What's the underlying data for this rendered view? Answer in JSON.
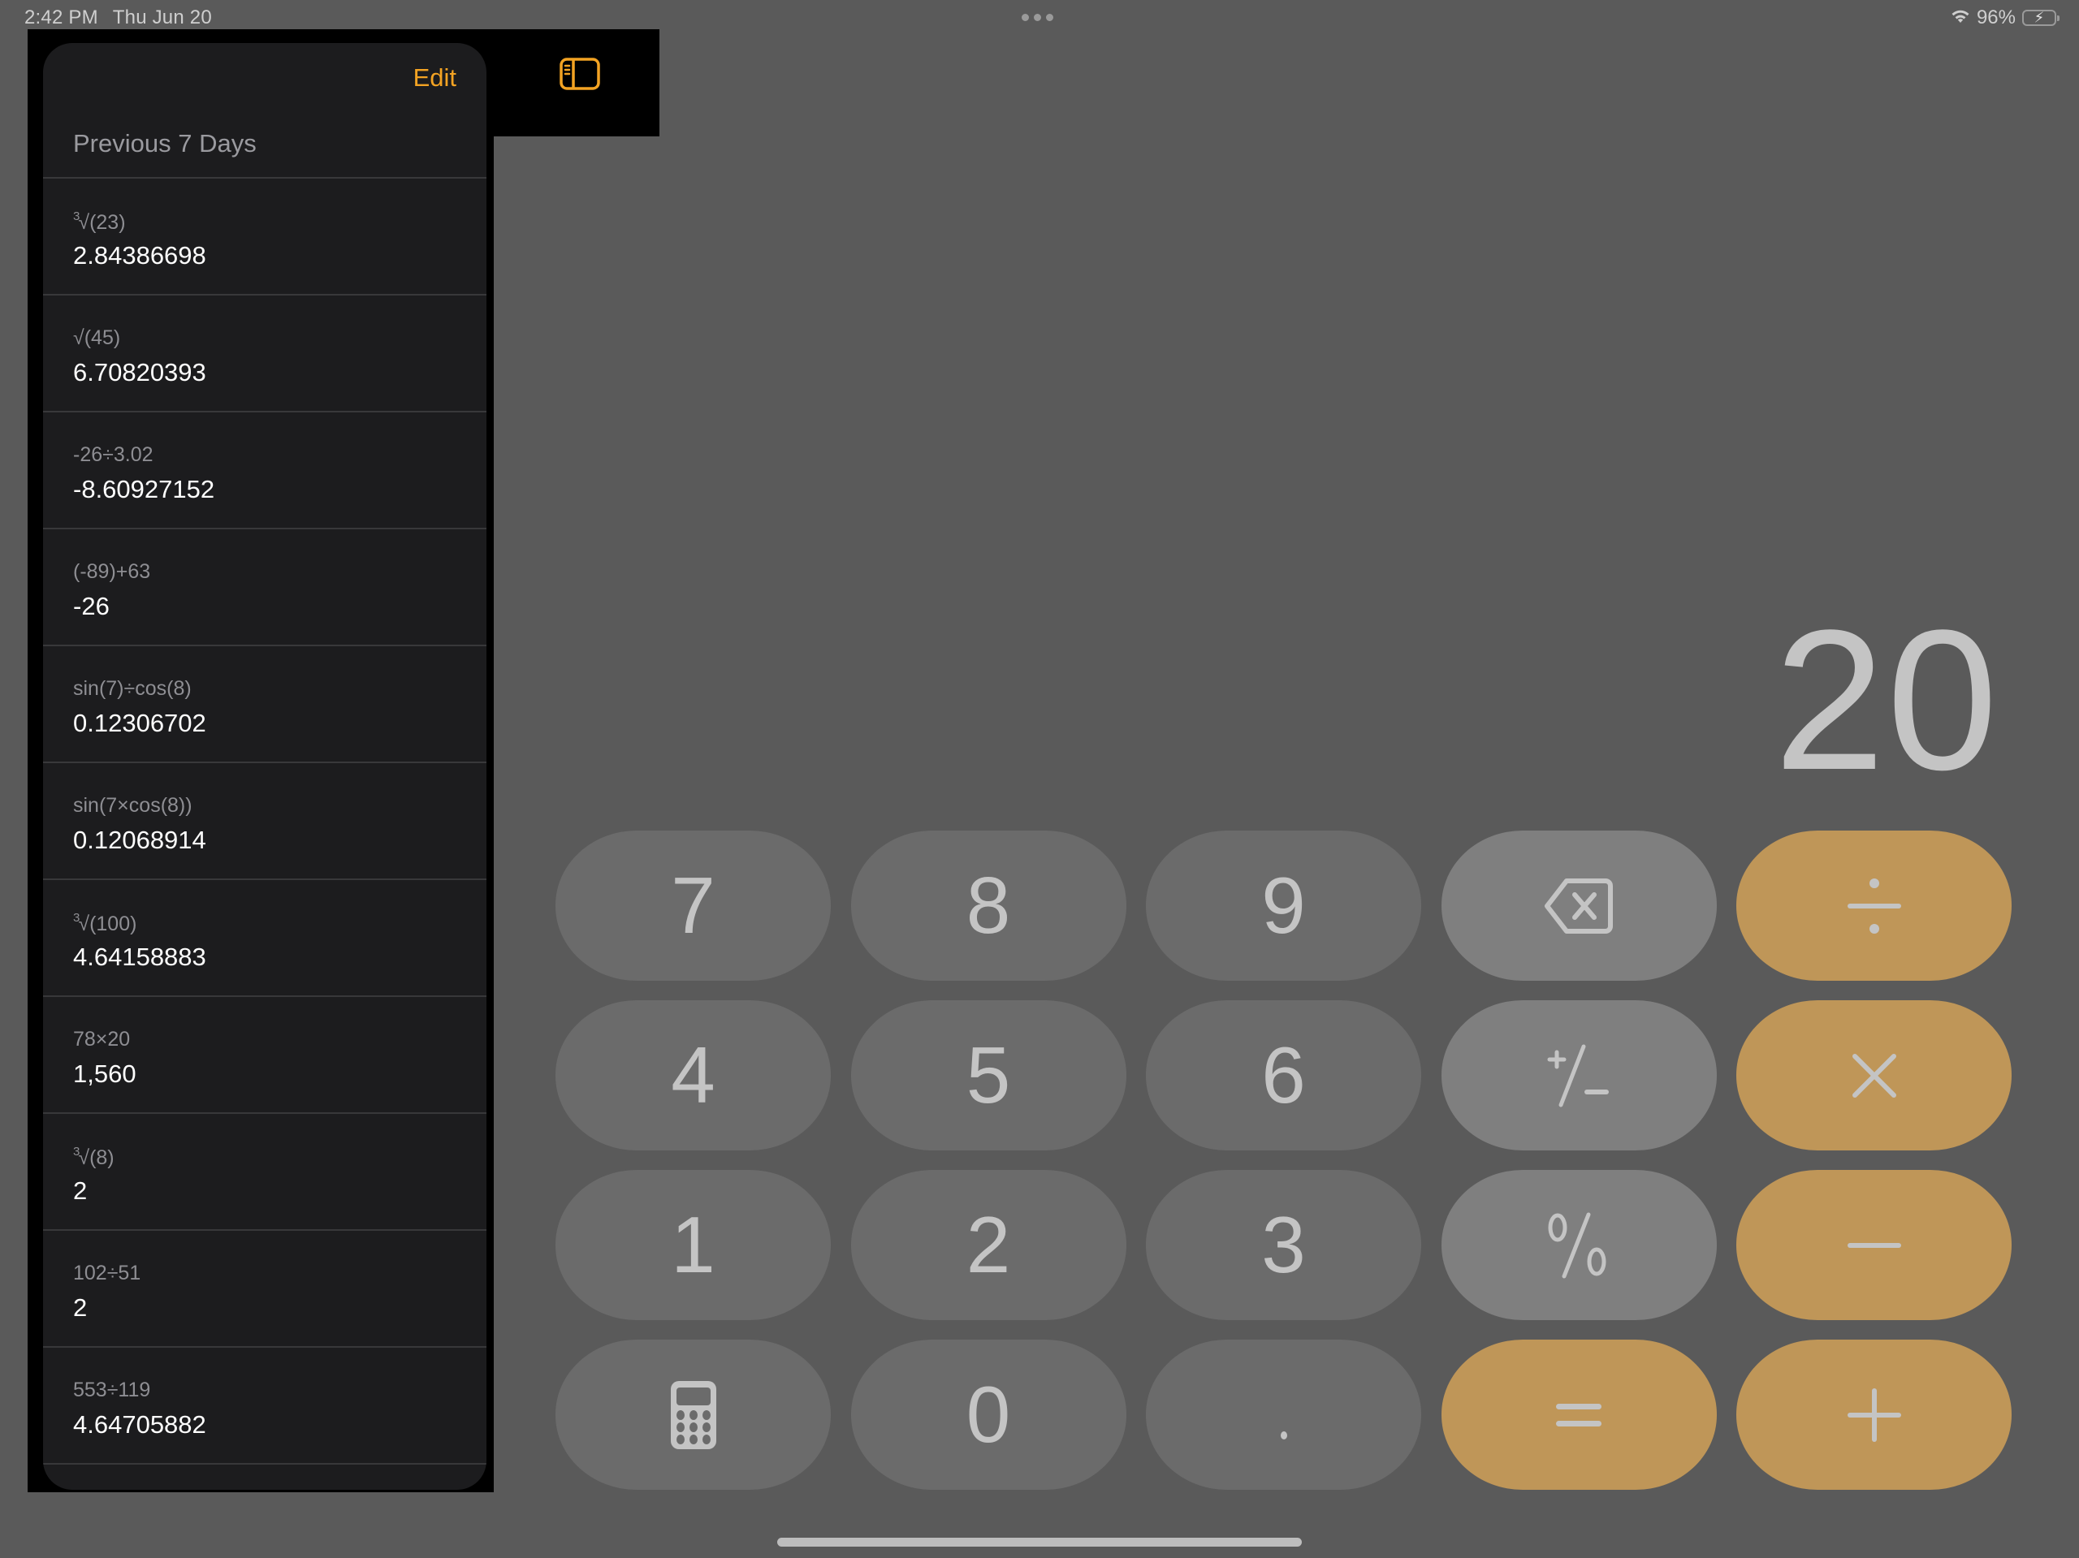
{
  "status_bar": {
    "time": "2:42 PM",
    "date": "Thu Jun 20",
    "battery_percent": "96%",
    "battery_level": 0.96,
    "wifi_icon": "wifi-icon",
    "battery_icon": "battery-charging-icon"
  },
  "colors": {
    "accent": "#f3a323",
    "operator_key": "#bf9658",
    "digit_key": "#6b6b6b",
    "function_key": "#7f7f7f",
    "background": "#5a5a5a",
    "panel": "#1c1c1e"
  },
  "sidebar": {
    "toggle_icon": "sidebar-left-icon",
    "edit_label": "Edit",
    "section_title": "Previous 7 Days",
    "history": [
      {
        "expression_prefix": "3",
        "expression": "√(23)",
        "result": "2.84386698"
      },
      {
        "expression_prefix": "",
        "expression": "√(45)",
        "result": "6.70820393"
      },
      {
        "expression_prefix": "",
        "expression": "-26÷3.02",
        "result": "-8.60927152"
      },
      {
        "expression_prefix": "",
        "expression": "(-89)+63",
        "result": "-26"
      },
      {
        "expression_prefix": "",
        "expression": "sin(7)÷cos(8)",
        "result": "0.12306702"
      },
      {
        "expression_prefix": "",
        "expression": "sin(7×cos(8))",
        "result": "0.12068914"
      },
      {
        "expression_prefix": "3",
        "expression": "√(100)",
        "result": "4.64158883"
      },
      {
        "expression_prefix": "",
        "expression": "78×20",
        "result": "1,560"
      },
      {
        "expression_prefix": "3",
        "expression": "√(8)",
        "result": "2"
      },
      {
        "expression_prefix": "",
        "expression": "102÷51",
        "result": "2"
      },
      {
        "expression_prefix": "",
        "expression": "553÷119",
        "result": "4.64705882"
      }
    ]
  },
  "display": {
    "value": "20"
  },
  "keypad": {
    "rows": [
      [
        {
          "label": "7",
          "kind": "digit",
          "name": "key-7"
        },
        {
          "label": "8",
          "kind": "digit",
          "name": "key-8"
        },
        {
          "label": "9",
          "kind": "digit",
          "name": "key-9"
        },
        {
          "label": "",
          "kind": "func",
          "icon": "backspace-icon",
          "name": "backspace-key"
        },
        {
          "label": "÷",
          "kind": "op",
          "name": "divide-key"
        }
      ],
      [
        {
          "label": "4",
          "kind": "digit",
          "name": "key-4"
        },
        {
          "label": "5",
          "kind": "digit",
          "name": "key-5"
        },
        {
          "label": "6",
          "kind": "digit",
          "name": "key-6"
        },
        {
          "label": "⁺∕₋",
          "kind": "func",
          "icon": "plus-minus-icon",
          "name": "plus-minus-key"
        },
        {
          "label": "×",
          "kind": "op",
          "name": "multiply-key"
        }
      ],
      [
        {
          "label": "1",
          "kind": "digit",
          "name": "key-1"
        },
        {
          "label": "2",
          "kind": "digit",
          "name": "key-2"
        },
        {
          "label": "3",
          "kind": "digit",
          "name": "key-3"
        },
        {
          "label": "%",
          "kind": "func",
          "name": "percent-key"
        },
        {
          "label": "−",
          "kind": "op",
          "name": "minus-key"
        }
      ],
      [
        {
          "label": "",
          "kind": "digit",
          "icon": "calculator-icon",
          "name": "calculator-mode-key"
        },
        {
          "label": "0",
          "kind": "digit",
          "name": "key-0"
        },
        {
          "label": ".",
          "kind": "digit",
          "name": "decimal-key"
        },
        {
          "label": "=",
          "kind": "op",
          "name": "equals-key"
        },
        {
          "label": "+",
          "kind": "op",
          "name": "plus-key"
        }
      ]
    ]
  }
}
